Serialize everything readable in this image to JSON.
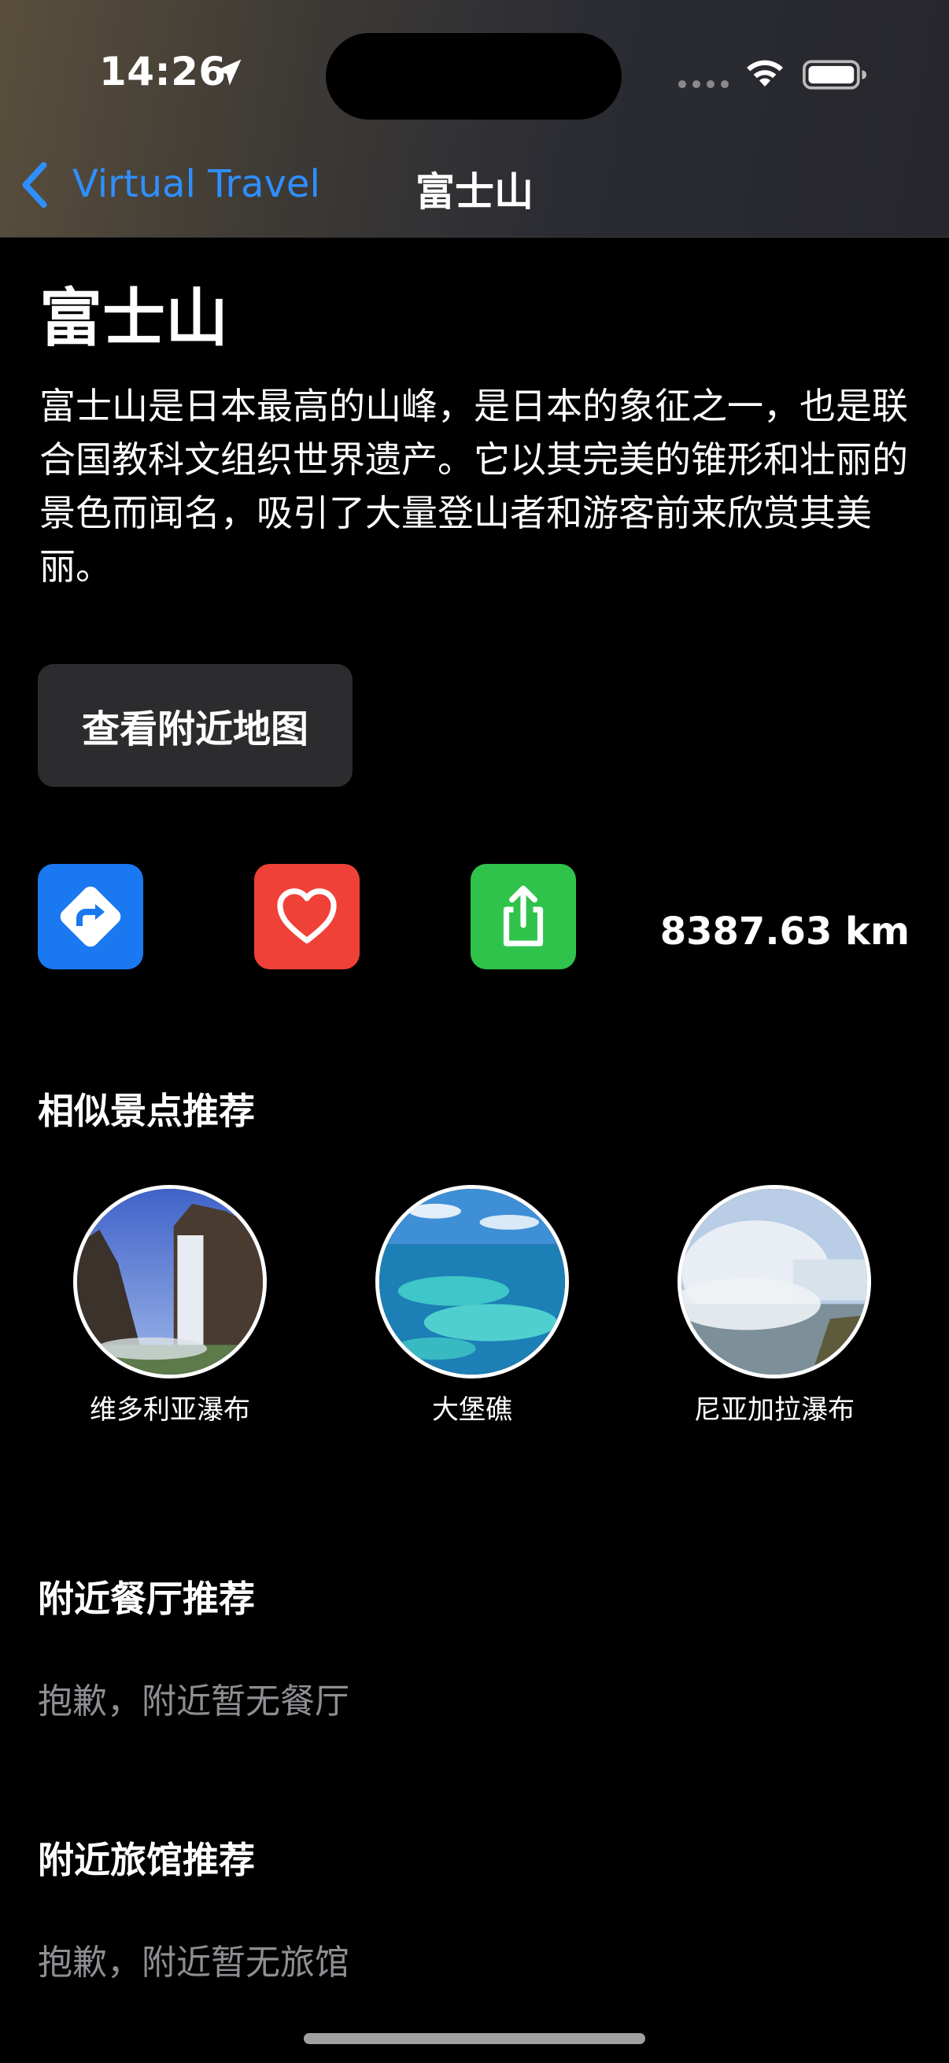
{
  "status_bar": {
    "time": "14:26"
  },
  "nav": {
    "back_label": "Virtual Travel",
    "title": "富士山"
  },
  "place": {
    "name": "富士山",
    "description": "富士山是日本最高的山峰，是日本的象征之一，也是联合国教科文组织世界遗产。它以其完美的锥形和壮丽的景色而闻名，吸引了大量登山者和游客前来欣赏其美丽。"
  },
  "map_button": {
    "label": "查看附近地图"
  },
  "actions": {
    "directions_icon": "directions-icon",
    "favorite_icon": "heart-icon",
    "share_icon": "share-icon",
    "distance": "8387.63 km"
  },
  "similar": {
    "title": "相似景点推荐",
    "items": [
      {
        "label": "维多利亚瀑布"
      },
      {
        "label": "大堡礁"
      },
      {
        "label": "尼亚加拉瀑布"
      }
    ]
  },
  "restaurants": {
    "title": "附近餐厅推荐",
    "empty": "抱歉，附近暂无餐厅"
  },
  "hotels": {
    "title": "附近旅馆推荐",
    "empty": "抱歉，附近暂无旅馆"
  },
  "colors": {
    "accent": "#2f8fff",
    "directions": "#1a78f0",
    "favorite": "#ef4137",
    "share": "#30c34c"
  }
}
